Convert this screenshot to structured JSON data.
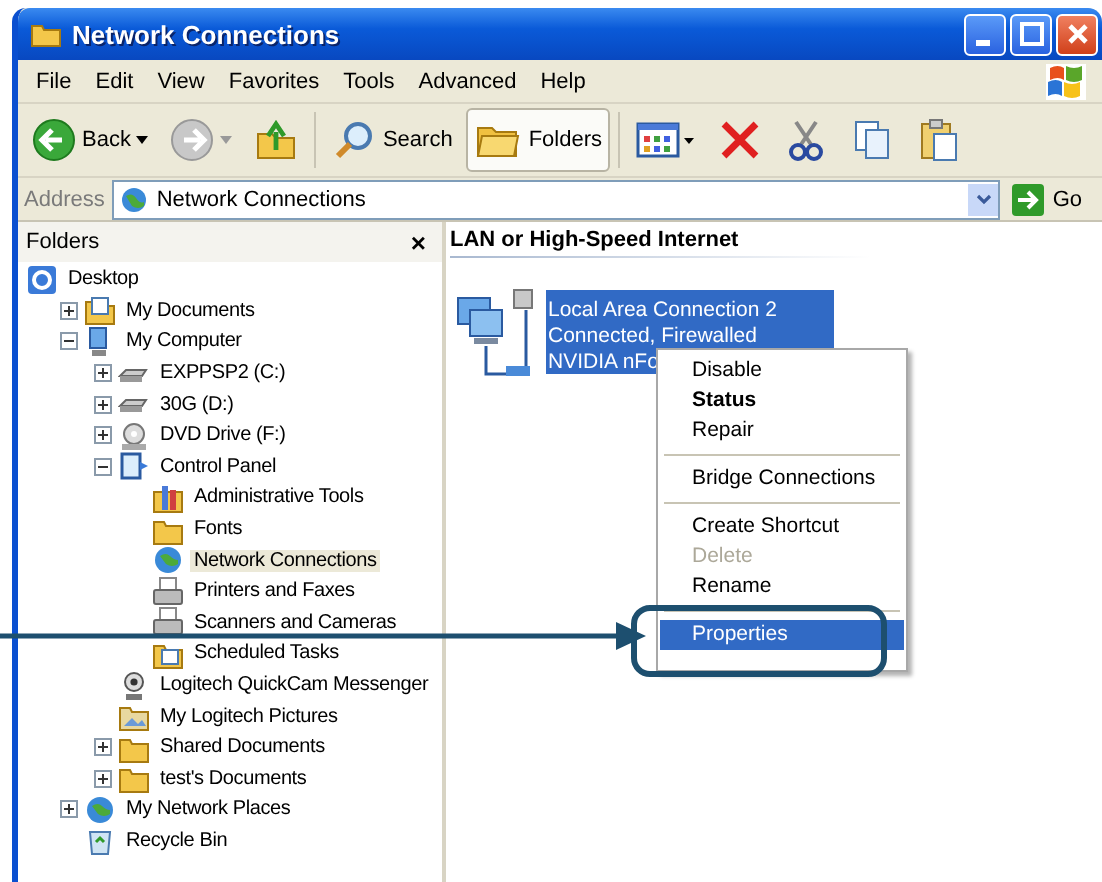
{
  "window": {
    "title": "Network Connections"
  },
  "menu_bar": [
    "File",
    "Edit",
    "View",
    "Favorites",
    "Tools",
    "Advanced",
    "Help"
  ],
  "toolbar": [
    {
      "kind": "back",
      "label": "Back",
      "selected": false
    },
    {
      "kind": "forward",
      "selected": false
    },
    {
      "kind": "up",
      "selected": false
    },
    {
      "kind": "search",
      "label": "Search",
      "selected": false
    },
    {
      "kind": "folders",
      "label": "Folders",
      "selected": true
    },
    {
      "kind": "views",
      "selected": false
    },
    {
      "kind": "delete",
      "selected": false
    },
    {
      "kind": "cut",
      "selected": false
    },
    {
      "kind": "copy",
      "selected": false
    },
    {
      "kind": "paste",
      "selected": false
    }
  ],
  "address_bar": {
    "label": "Address",
    "value": "Network Connections",
    "go_label": "Go"
  },
  "folders_pane": {
    "title": "Folders",
    "close": "×"
  },
  "tree": [
    {
      "label": "Desktop",
      "kind": "desktop",
      "selected": false,
      "children": [
        {
          "label": "My Documents",
          "kind": "documents",
          "expanded": false,
          "selected": false
        },
        {
          "label": "My Computer",
          "kind": "computer",
          "expanded": true,
          "selected": false,
          "children": [
            {
              "label": "EXPPSP2 (C:)",
              "kind": "drive",
              "expanded": false,
              "selected": false
            },
            {
              "label": "30G (D:)",
              "kind": "drive",
              "expanded": false,
              "selected": false
            },
            {
              "label": "DVD Drive (F:)",
              "kind": "dvd",
              "expanded": false,
              "selected": false
            },
            {
              "label": "Control Panel",
              "kind": "control",
              "expanded": true,
              "selected": false,
              "children": [
                {
                  "label": "Administrative Tools",
                  "kind": "tools",
                  "selected": false
                },
                {
                  "label": "Fonts",
                  "kind": "folder",
                  "selected": false
                },
                {
                  "label": "Network Connections",
                  "kind": "network",
                  "selected": true
                },
                {
                  "label": "Printers and Faxes",
                  "kind": "printer",
                  "selected": false
                },
                {
                  "label": "Scanners and Cameras",
                  "kind": "printer",
                  "selected": false
                },
                {
                  "label": "Scheduled Tasks",
                  "kind": "tasks",
                  "selected": false
                }
              ]
            },
            {
              "label": "Logitech QuickCam Messenger",
              "kind": "webcam",
              "selected": false
            },
            {
              "label": "My Logitech Pictures",
              "kind": "pictures",
              "selected": false
            },
            {
              "label": "Shared Documents",
              "kind": "folder",
              "expanded": false,
              "selected": false
            },
            {
              "label": "test's Documents",
              "kind": "folder",
              "expanded": false,
              "selected": false
            }
          ]
        },
        {
          "label": "My Network Places",
          "kind": "network",
          "expanded": false,
          "selected": false
        },
        {
          "label": "Recycle Bin",
          "kind": "recycle",
          "selected": false
        }
      ]
    }
  ],
  "section_heading": "LAN or High-Speed Internet",
  "connection": {
    "lines": [
      "Local Area Connection 2",
      "Connected, Firewalled",
      "NVIDIA nFo"
    ],
    "selected": true
  },
  "context_menu": [
    {
      "kind": "item",
      "label": "Disable",
      "default": false,
      "disabled": false,
      "selected": false
    },
    {
      "kind": "item",
      "label": "Status",
      "default": true,
      "disabled": false,
      "selected": false
    },
    {
      "kind": "item",
      "label": "Repair",
      "default": false,
      "disabled": false,
      "selected": false
    },
    {
      "kind": "separator"
    },
    {
      "kind": "item",
      "label": "Bridge Connections",
      "default": false,
      "disabled": false,
      "selected": false
    },
    {
      "kind": "separator"
    },
    {
      "kind": "item",
      "label": "Create Shortcut",
      "default": false,
      "disabled": false,
      "selected": false
    },
    {
      "kind": "item",
      "label": "Delete",
      "default": false,
      "disabled": true,
      "selected": false
    },
    {
      "kind": "item",
      "label": "Rename",
      "default": false,
      "disabled": false,
      "selected": false
    },
    {
      "kind": "separator"
    },
    {
      "kind": "item",
      "label": "Properties",
      "default": false,
      "disabled": false,
      "selected": true
    }
  ]
}
